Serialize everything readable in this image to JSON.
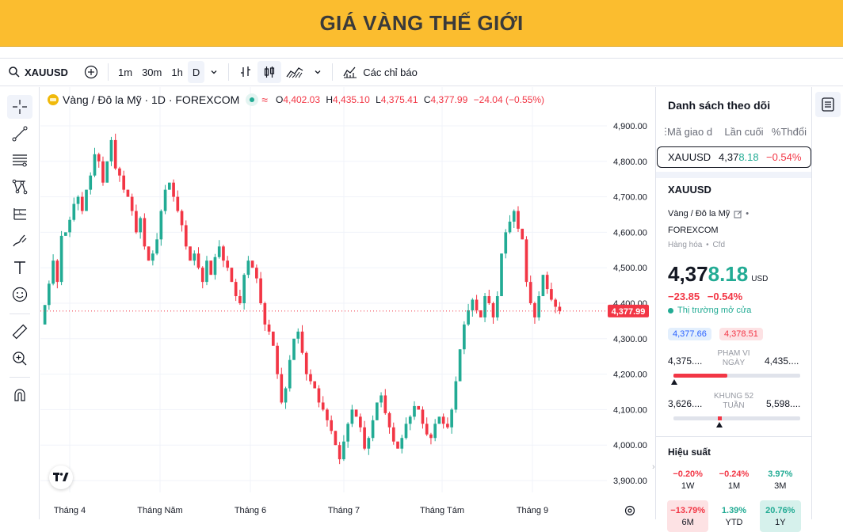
{
  "banner": {
    "title": "GIÁ VÀNG THẾ GIỚI"
  },
  "toolbar": {
    "symbol": "XAUUSD",
    "intervals": [
      "1m",
      "30m",
      "1h",
      "D"
    ],
    "indicators_label": "Các chỉ báo"
  },
  "legend": {
    "title": "Vàng / Đô la Mỹ · 1D · FOREXCOM",
    "o_label": "O",
    "o_value": "4,402.03",
    "h_label": "H",
    "h_value": "4,435.10",
    "l_label": "L",
    "l_value": "4,375.41",
    "c_label": "C",
    "c_value": "4,377.99",
    "change": "−24.04 (−0.55%)"
  },
  "chart_data": {
    "type": "candlestick",
    "x_ticks": [
      "Tháng 4",
      "Tháng Năm",
      "Tháng 6",
      "Tháng 7",
      "Tháng Tám",
      "Tháng 9"
    ],
    "y_ticks": [
      "4,900.00",
      "4,800.00",
      "4,700.00",
      "4,600.00",
      "4,500.00",
      "4,400.00",
      "4,300.00",
      "4,200.00",
      "4,100.00",
      "4,000.00",
      "3,900.00"
    ],
    "ylim": [
      3885,
      4935
    ],
    "last_price": 4377.99,
    "last_price_label": "4,377.99",
    "closes": [
      4395,
      4455,
      4520,
      4460,
      4590,
      4600,
      4635,
      4680,
      4700,
      4660,
      4720,
      4760,
      4820,
      4800,
      4740,
      4800,
      4860,
      4780,
      4760,
      4720,
      4700,
      4660,
      4600,
      4640,
      4560,
      4520,
      4540,
      4580,
      4660,
      4720,
      4740,
      4700,
      4660,
      4620,
      4560,
      4520,
      4540,
      4500,
      4460,
      4520,
      4480,
      4530,
      4560,
      4520,
      4500,
      4460,
      4420,
      4400,
      4480,
      4520,
      4500,
      4470,
      4400,
      4340,
      4320,
      4280,
      4200,
      4120,
      4160,
      4240,
      4300,
      4320,
      4260,
      4200,
      4180,
      4160,
      4120,
      4100,
      4070,
      4040,
      4000,
      3960,
      4010,
      4060,
      4100,
      4080,
      4050,
      3990,
      4020,
      4070,
      4120,
      4140,
      4090,
      4050,
      4010,
      3990,
      4020,
      4060,
      4080,
      4110,
      4100,
      4060,
      4030,
      4020,
      4060,
      4080,
      4060,
      4050,
      4100,
      4180,
      4270,
      4340,
      4380,
      4410,
      4380,
      4360,
      4420,
      4400,
      4360,
      4420,
      4540,
      4600,
      4630,
      4660,
      4610,
      4580,
      4460,
      4400,
      4360,
      4420,
      4480,
      4440,
      4410,
      4390,
      4378
    ],
    "wicks_hi": 18,
    "wicks_lo": 18
  },
  "watchlist": {
    "title": "Danh sách theo dõi",
    "columns": [
      "Mã giao d",
      "Lần cuối",
      "%Thđổi"
    ],
    "rows": [
      {
        "symbol": "XAUUSD",
        "last_a": "4,37",
        "last_b": "8.18",
        "change": "−0.54%"
      }
    ]
  },
  "details": {
    "symbol": "XAUUSD",
    "name": "Vàng / Đô la Mỹ",
    "exchange": "FOREXCOM",
    "category": "Hàng hóa",
    "type": "Cfd",
    "price_a": "4,37",
    "price_b": "8.18",
    "currency": "USD",
    "change_abs": "−23.85",
    "change_pct": "−0.54%",
    "market_status": "Thị trường mở cửa",
    "bid": "4,377.66",
    "ask": "4,378.51",
    "day_low": "4,375....",
    "day_label": "PHẠM VI NGÀY",
    "day_high": "4,435....",
    "w52_low": "3,626....",
    "w52_label": "KHUNG 52 TUẦN",
    "w52_high": "5,598....",
    "perf_title": "Hiệu suất",
    "perf": [
      {
        "value": "−0.20%",
        "label": "1W",
        "kind": "neg"
      },
      {
        "value": "−0.24%",
        "label": "1M",
        "kind": "neg"
      },
      {
        "value": "3.97%",
        "label": "3M",
        "kind": "pos"
      },
      {
        "value": "−13.79%",
        "label": "6M",
        "kind": "negbg"
      },
      {
        "value": "1.39%",
        "label": "YTD",
        "kind": "pos"
      },
      {
        "value": "20.76%",
        "label": "1Y",
        "kind": "posbg"
      }
    ]
  },
  "colors": {
    "up": "#22ab94",
    "down": "#f23645",
    "banner": "#fbbd2f",
    "accent": "#2962ff"
  }
}
